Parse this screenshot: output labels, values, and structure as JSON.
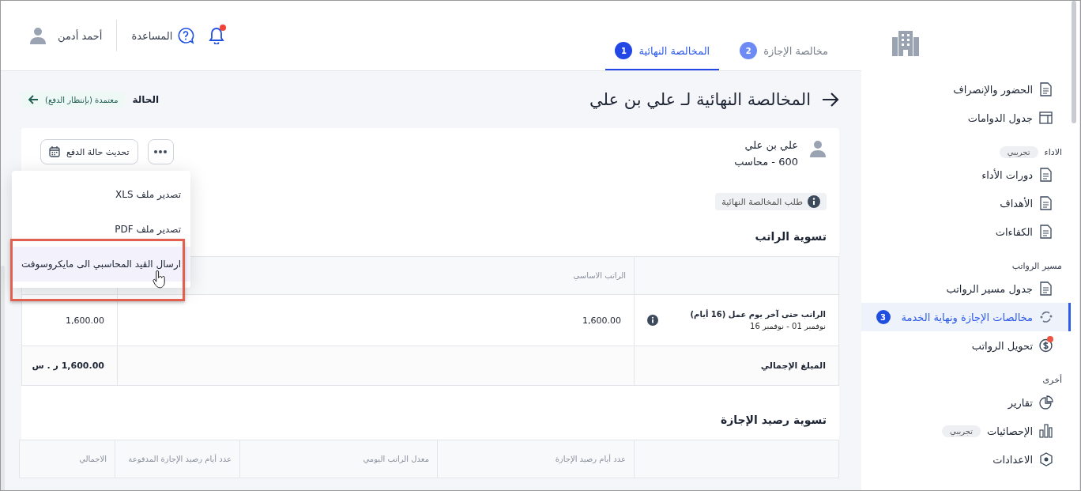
{
  "header": {
    "tabs": [
      {
        "label": "مخالصة الإجازة",
        "number": "2",
        "selected": false
      },
      {
        "label": "المخالصة النهائية",
        "number": "1",
        "selected": true
      }
    ],
    "notifications": {
      "unread": true
    },
    "help": "المساعدة",
    "user_name": "أحمد أدمن"
  },
  "page": {
    "title": "المخالصة النهائية لـ علي بن علي",
    "status_label": "الحالة",
    "status": "معتمدة (بإنتظار الدفع)"
  },
  "employee": {
    "name": "علي بن علي",
    "details": "600 - محاسب",
    "request_tag": "طلب المخالصة النهائية"
  },
  "actions": {
    "update_button": "تحديث حالة الدفع",
    "menu": {
      "open": true,
      "items": [
        {
          "label": "تصدير ملف XLS",
          "selected": false,
          "outlined": false
        },
        {
          "label": "تصدير ملف PDF",
          "selected": false,
          "outlined": false
        },
        {
          "label": "ارسال القيد المحاسبي الى مايكروسوفت",
          "selected": true,
          "outlined": true
        }
      ]
    }
  },
  "salary_settlement": {
    "title": "تسوية الراتب",
    "column_2": "الراتب الاساسي",
    "rows": [
      {
        "description": "الراتب حتى آخر يوم عمل (16 أيام)",
        "period": "نوفمبر 01 - نوفمبر 16",
        "basic_salary": "1,600.00",
        "total": "1,600.00"
      }
    ],
    "total_row": {
      "label": "المبلغ الإجمالي",
      "amount": "1,600.00 ر . س"
    }
  },
  "leave_settlement": {
    "title": "تسوية رصيد الإجازة",
    "columns": [
      "عدد أيام رصيد الإجازة",
      "معدل الراتب اليومي",
      "عدد أيام رصيد الإجازة المدفوعة",
      "الاجمالي"
    ]
  },
  "sidebar": {
    "sections": [
      {
        "items": [
          {
            "label": "الحضور والإنصراف",
            "selected": false
          },
          {
            "label": "جدول الدوامات",
            "selected": false
          }
        ]
      },
      {
        "heading": "الاداء",
        "badge": "تجريبي",
        "items": [
          {
            "label": "دورات الأداء",
            "selected": false
          },
          {
            "label": "الأهداف",
            "selected": false
          },
          {
            "label": "الكفاءات",
            "selected": false
          }
        ]
      },
      {
        "heading": "مسير الرواتب",
        "items": [
          {
            "label": "جدول مسير الرواتب",
            "selected": false
          },
          {
            "label": "مخالصات الإجازة ونهاية الخدمة",
            "selected": true,
            "count": "3"
          },
          {
            "label": "تحويل الرواتب",
            "selected": false,
            "dot": true
          }
        ]
      },
      {
        "heading": "أخرى",
        "items": [
          {
            "label": "تقارير",
            "selected": false
          },
          {
            "label": "الإحصائيات",
            "selected": false,
            "badge": "تجريبي"
          },
          {
            "label": "الاعدادات",
            "selected": false
          }
        ]
      }
    ]
  }
}
